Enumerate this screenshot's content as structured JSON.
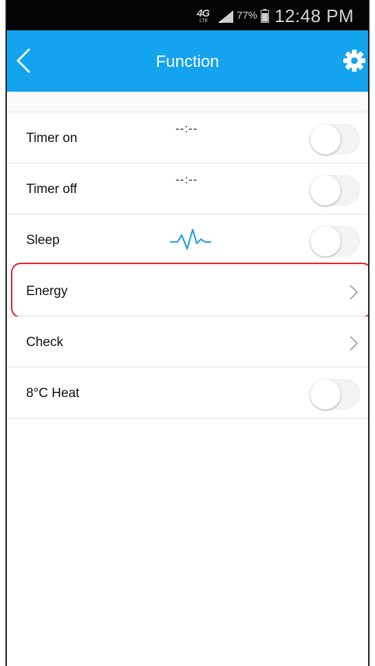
{
  "status_bar": {
    "network": "4G",
    "network_sub": "LTE",
    "battery_percent": "77%",
    "battery_level": 0.77,
    "time": "12:48 PM"
  },
  "app_bar": {
    "title": "Function",
    "back_icon": "chevron-left-icon",
    "settings_icon": "gear-icon",
    "background": "#13a3ef"
  },
  "rows": [
    {
      "label": "Timer on",
      "value": "--:--",
      "control": "toggle",
      "enabled": false
    },
    {
      "label": "Timer off",
      "value": "--:--",
      "control": "toggle",
      "enabled": false
    },
    {
      "label": "Sleep",
      "icon": "sleep-wave-icon",
      "control": "toggle",
      "enabled": false
    },
    {
      "label": "Energy",
      "control": "chevron",
      "highlighted": true
    },
    {
      "label": "Check",
      "control": "chevron"
    },
    {
      "label": "8°C Heat",
      "control": "toggle",
      "enabled": false
    }
  ],
  "colors": {
    "accent": "#13a3ef",
    "highlight": "#e51b2d",
    "wave": "#1f9fe6"
  }
}
